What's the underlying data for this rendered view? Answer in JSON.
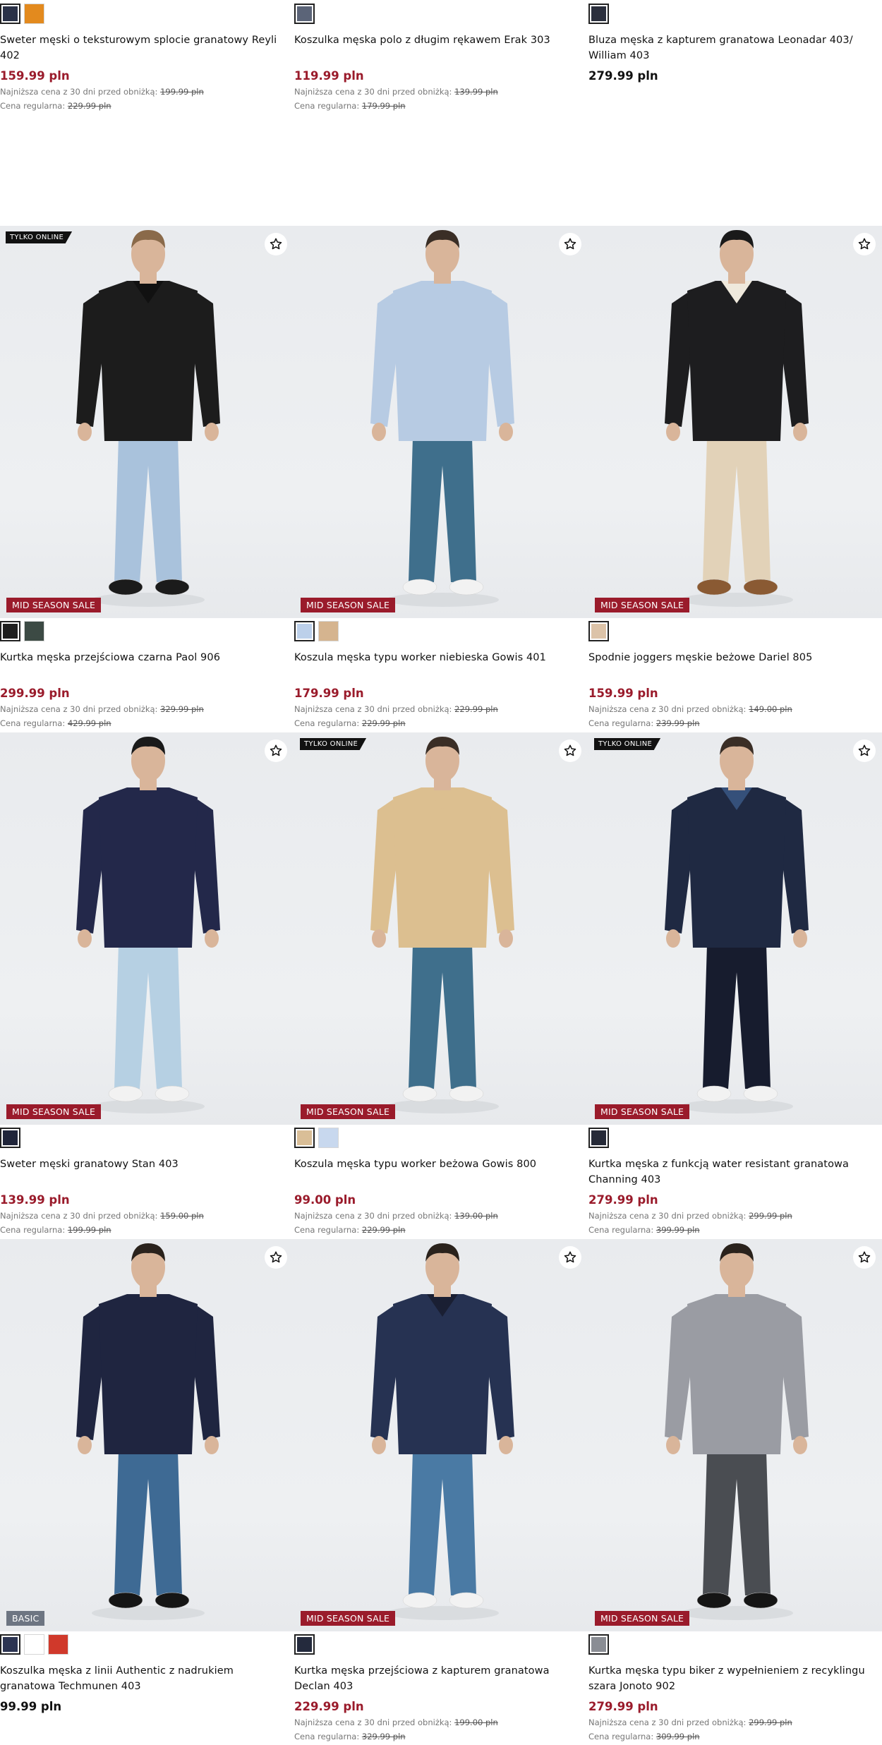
{
  "labels": {
    "lowest_price_label": "Najniższa cena z 30 dni przed obniżką:",
    "regular_price_label": "Cena regularna:",
    "online_only": "TYLKO ONLINE",
    "mid_season_sale": "MID SEASON SALE",
    "basic": "BASIC"
  },
  "colors": {
    "sale_red": "#9a1b2b",
    "basic_badge": "#6d7582"
  },
  "top_row": [
    {
      "swatches": [
        "#2b3248",
        "#e38a1e"
      ],
      "title": "Sweter męski o teksturowym splocie granatowy Reyli 402",
      "price": "159.99 pln",
      "on_sale": true,
      "lowest": "199.99 pln",
      "regular": "229.99 pln"
    },
    {
      "swatches": [
        "#5b6478"
      ],
      "title": "Koszulka męska polo z długim rękawem Erak 303",
      "price": "119.99 pln",
      "on_sale": true,
      "lowest": "139.99 pln",
      "regular": "179.99 pln"
    },
    {
      "swatches": [
        "#2b2f3d"
      ],
      "title": "Bluza męska z kapturem granatowa Leonadar 403/ William 403",
      "price": "279.99 pln",
      "on_sale": false
    }
  ],
  "products": [
    {
      "online_only": true,
      "badge": "MID SEASON SALE",
      "swatches": [
        "#1e1e1e",
        "#3c4a44"
      ],
      "title": "Kurtka męska przejściowa czarna Paol 906",
      "price": "299.99 pln",
      "on_sale": true,
      "lowest": "329.99 pln",
      "regular": "429.99 pln",
      "model": {
        "top": "#1c1c1c",
        "inner": "#111",
        "pants": "#a9c2dc",
        "shoes": "#1b1b1b",
        "hair": "#8a6a4a"
      }
    },
    {
      "online_only": false,
      "badge": "MID SEASON SALE",
      "swatches": [
        "#bcd0ea",
        "#d5b48f"
      ],
      "title": "Koszula męska typu worker niebieska Gowis 401",
      "price": "179.99 pln",
      "on_sale": true,
      "lowest": "229.99 pln",
      "regular": "229.99 pln",
      "model": {
        "top": "#b7cbe3",
        "inner": "#b7cbe3",
        "pants": "#3f6f8c",
        "shoes": "#f2f2f2",
        "hair": "#3a2e26"
      }
    },
    {
      "online_only": false,
      "badge": "MID SEASON SALE",
      "swatches": [
        "#dcc3a8"
      ],
      "title": "Spodnie joggers męskie beżowe Dariel 805",
      "price": "159.99 pln",
      "on_sale": true,
      "lowest": "149.00 pln",
      "regular": "239.99 pln",
      "model": {
        "top": "#1d1d1f",
        "inner": "#efe9dc",
        "pants": "#e2d2b8",
        "shoes": "#8a5a33",
        "hair": "#1a1a1a"
      }
    },
    {
      "online_only": false,
      "badge": "MID SEASON SALE",
      "swatches": [
        "#20253a"
      ],
      "title": "Sweter męski granatowy Stan 403",
      "price": "139.99 pln",
      "on_sale": true,
      "lowest": "159.00 pln",
      "regular": "199.99 pln",
      "model": {
        "top": "#23284a",
        "inner": "#23284a",
        "pants": "#b6d0e3",
        "shoes": "#f2f2f2",
        "hair": "#1a1a1a"
      }
    },
    {
      "online_only": true,
      "badge": "MID SEASON SALE",
      "swatches": [
        "#d9be97",
        "#c8d8ee"
      ],
      "title": "Koszula męska typu worker beżowa Gowis 800",
      "price": "99.00 pln",
      "on_sale": true,
      "lowest": "139.00 pln",
      "regular": "229.99 pln",
      "model": {
        "top": "#dcbf90",
        "inner": "#dcbf90",
        "pants": "#3f6f8c",
        "shoes": "#f2f2f2",
        "hair": "#3a2e26"
      }
    },
    {
      "online_only": true,
      "badge": "MID SEASON SALE",
      "swatches": [
        "#262a38"
      ],
      "title": "Kurtka męska z funkcją water resistant granatowa Channing 403",
      "price": "279.99 pln",
      "on_sale": true,
      "lowest": "299.99 pln",
      "regular": "399.99 pln",
      "model": {
        "top": "#1f2942",
        "inner": "#35507a",
        "pants": "#171c2e",
        "shoes": "#f2f2f2",
        "hair": "#3a2e26"
      }
    },
    {
      "online_only": false,
      "badge": "BASIC",
      "swatches": [
        "#2c3452",
        "#ffffff",
        "#d0392b"
      ],
      "title": "Koszulka męska z linii Authentic z nadrukiem granatowa Techmunen 403",
      "price": "99.99 pln",
      "on_sale": false,
      "model": {
        "top": "#1f2540",
        "inner": "#1f2540",
        "pants": "#3e6a94",
        "shoes": "#151515",
        "hair": "#2a221c"
      }
    },
    {
      "online_only": false,
      "badge": "MID SEASON SALE",
      "swatches": [
        "#242a3d"
      ],
      "title": "Kurtka męska przejściowa z kapturem granatowa Declan 403",
      "price": "229.99 pln",
      "on_sale": true,
      "lowest": "199.00 pln",
      "regular": "329.99 pln",
      "model": {
        "top": "#263252",
        "inner": "#1a1f33",
        "pants": "#4a7aa4",
        "shoes": "#f2f2f2",
        "hair": "#2a221c"
      }
    },
    {
      "online_only": false,
      "badge": "MID SEASON SALE",
      "swatches": [
        "#8a8d94"
      ],
      "title": "Kurtka męska typu biker z wypełnieniem z recyklingu szara Jonoto 902",
      "price": "279.99 pln",
      "on_sale": true,
      "lowest": "299.99 pln",
      "regular": "309.99 pln",
      "model": {
        "top": "#9a9ca3",
        "inner": "#9a9ca3",
        "pants": "#4a4d52",
        "shoes": "#151515",
        "hair": "#2a221c"
      }
    }
  ]
}
